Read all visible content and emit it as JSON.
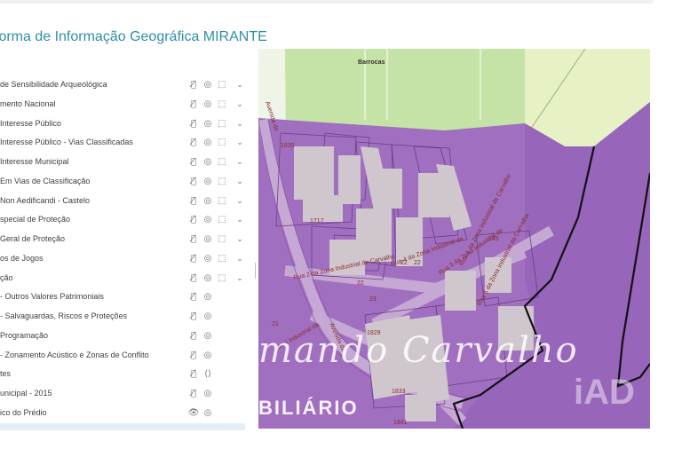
{
  "app": {
    "title": "forma de Informação Geográfica MIRANTE"
  },
  "icons": {
    "visibility": "eye-slash-icon",
    "target": "target-icon",
    "select": "select-icon",
    "expand": "chevron-down-icon"
  },
  "colors": {
    "title": "#2f8fa8",
    "zone_purple": "#a16fc0",
    "green_area": "#c5e3a6",
    "building": "#cfc7cd",
    "boundary": "#111111"
  },
  "layers": [
    {
      "label": "de Sensibilidade Arqueológica",
      "eye": "👁̸",
      "target": "◎",
      "select": "⬚",
      "chevron": "⌄"
    },
    {
      "label": "mento Nacional",
      "eye": "👁̸",
      "target": "◎",
      "select": "⬚",
      "chevron": "⌄"
    },
    {
      "label": "Interesse Público",
      "eye": "👁̸",
      "target": "◎",
      "select": "⬚",
      "chevron": "⌄"
    },
    {
      "label": "Interesse Público - Vias Classificadas",
      "eye": "👁̸",
      "target": "◎",
      "select": "⬚",
      "chevron": "⌄"
    },
    {
      "label": "Interesse Municipal",
      "eye": "👁̸",
      "target": "◎",
      "select": "⬚",
      "chevron": "⌄"
    },
    {
      "label": "Em Vias de Classificação",
      "eye": "👁̸",
      "target": "◎",
      "select": "⬚",
      "chevron": "⌄"
    },
    {
      "label": "Non Aedificandi - Castelo",
      "eye": "👁̸",
      "target": "◎",
      "select": "⬚",
      "chevron": "⌄"
    },
    {
      "label": "special de Proteção",
      "eye": "👁̸",
      "target": "◎",
      "select": "⬚",
      "chevron": "⌄"
    },
    {
      "label": "Geral de Proteção",
      "eye": "👁̸",
      "target": "◎",
      "select": "⬚",
      "chevron": "⌄"
    },
    {
      "label": "os de Jogos",
      "eye": "👁̸",
      "target": "◎",
      "select": "⬚",
      "chevron": "⌄"
    },
    {
      "label": "ção",
      "eye": "👁̸",
      "target": "◎",
      "select": "⬚",
      "chevron": "⌄"
    },
    {
      "label": "- Outros Valores Patrimoniais",
      "eye": "👁̸",
      "target": "◎",
      "select": "",
      "chevron": ""
    },
    {
      "label": "- Salvaguardas, Riscos e Proteções",
      "eye": "👁̸",
      "target": "◎",
      "select": "",
      "chevron": ""
    },
    {
      "label": "Programação",
      "eye": "👁̸",
      "target": "◎",
      "select": "",
      "chevron": ""
    },
    {
      "label": "- Zonamento Acústico e Zonas de Conflito",
      "eye": "👁̸",
      "target": "◎",
      "select": "",
      "chevron": ""
    },
    {
      "label": "tes",
      "eye": "👁̸",
      "target": "⟨⟩",
      "select": "",
      "chevron": ""
    },
    {
      "label": "unicipal - 2015",
      "eye": "👁̸",
      "target": "◎",
      "select": "",
      "chevron": ""
    },
    {
      "label": "ico do Prédio",
      "eye": "👁",
      "target": "◎",
      "select": "",
      "chevron": ""
    }
  ],
  "map": {
    "place_label": "Barrocas",
    "road_labels": [
      "Avenida do",
      "Rua 1 da Zona Industrial de Carvalho",
      "Rua 3 da Zona Industrial de",
      "Rua 4 da Zona Industrial de",
      "Rua 2 da Zona Industrial de Carvalho",
      "Zona Industrial da",
      "Avenida da",
      "Rua 5 da Zona Industrial da Carvalha"
    ],
    "parcel_numbers": [
      "1835",
      "1717",
      "1829",
      "145",
      "22",
      "22",
      "23",
      "21",
      "22",
      "1833",
      "1841"
    ]
  },
  "watermark": {
    "line1": "mando Carvalho",
    "line2": "BILIÁRIO",
    "logo": "iAD"
  }
}
